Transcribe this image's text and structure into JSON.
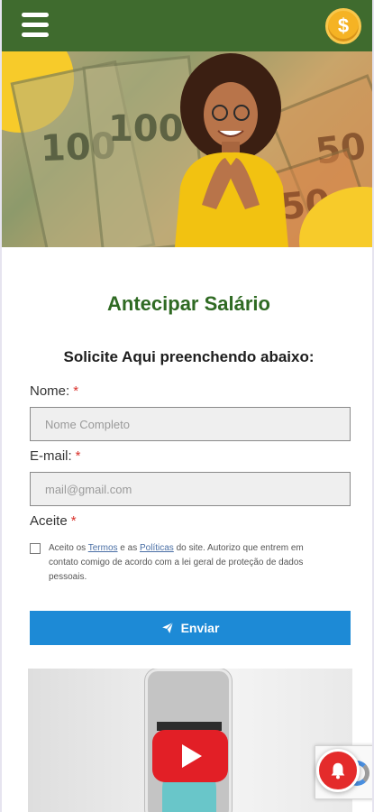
{
  "header": {
    "menu_icon": "hamburger-menu-icon",
    "coin_icon": "dollar-coin-icon",
    "coin_symbol": "$"
  },
  "hero": {
    "banknote_values": [
      "100",
      "100",
      "50",
      "50"
    ]
  },
  "form": {
    "title": "Antecipar Salário",
    "subtitle": "Solicite Aqui preenchendo abaixo:",
    "name_label": "Nome:",
    "name_placeholder": "Nome Completo",
    "email_label": "E-mail:",
    "email_placeholder": "mail@gmail.com",
    "required_mark": "*",
    "accept_label": "Aceite",
    "consent_prefix": "Aceito os ",
    "terms_link": "Termos",
    "consent_and": " e as ",
    "policies_link": "Políticas",
    "consent_suffix": " do site. Autorizo que entrem em contato comigo de acordo com a lei geral de proteção de dados pessoais.",
    "submit_label": "Enviar",
    "submit_icon": "paper-plane-icon"
  },
  "video": {
    "play_icon": "youtube-play-icon"
  },
  "widgets": {
    "bell_icon": "notification-bell-icon",
    "recaptcha_icon": "recaptcha-icon"
  },
  "colors": {
    "header_green": "#3f6b2e",
    "title_green": "#2f6a23",
    "button_blue": "#1d8ad6",
    "required_red": "#d9302a",
    "coin_gold": "#f5b324"
  }
}
